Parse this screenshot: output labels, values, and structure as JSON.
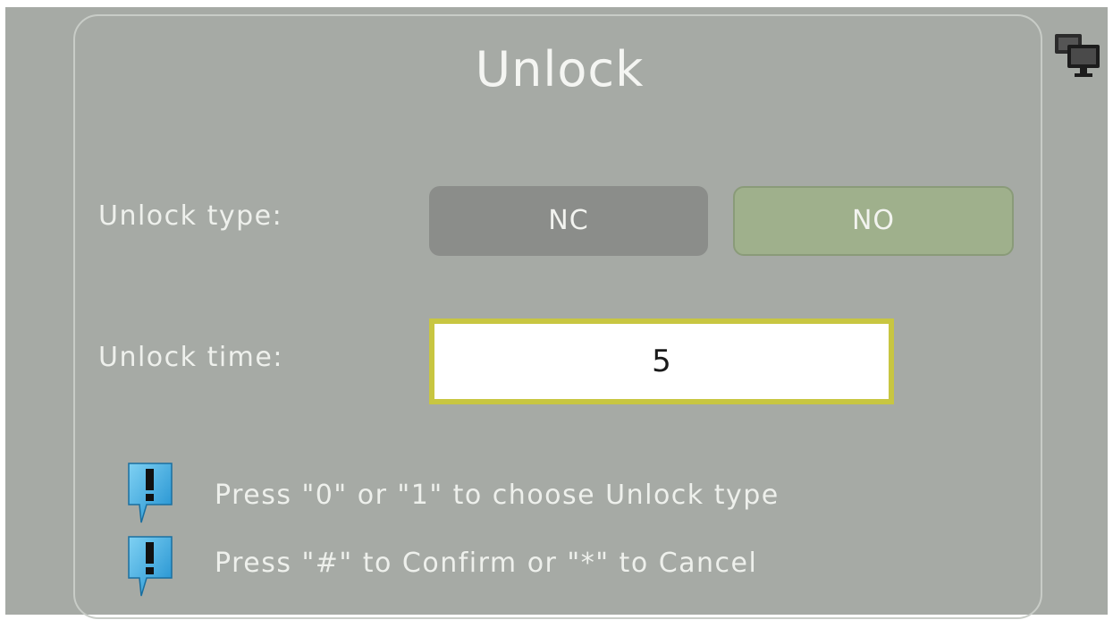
{
  "dialog": {
    "title": "Unlock"
  },
  "unlock_type": {
    "label": "Unlock type:",
    "options": [
      "NC",
      "NO"
    ],
    "selected": "NO"
  },
  "unlock_time": {
    "label": "Unlock time:",
    "value": "5"
  },
  "hints": [
    {
      "text": "Press \"0\" or \"1\" to choose Unlock type",
      "icon": "exclamation-bubble-icon"
    },
    {
      "text": "Press \"#\" to Confirm or \"*\" to Cancel",
      "icon": "exclamation-bubble-icon"
    }
  ],
  "icons": {
    "corner": "monitor-icon"
  },
  "colors": {
    "background": "#a6aaa5",
    "nc_button": "#8b8d8a",
    "no_button_selected": "#9fb08c",
    "input_border": "#c8c641",
    "hint_icon": "#3aaee2"
  }
}
